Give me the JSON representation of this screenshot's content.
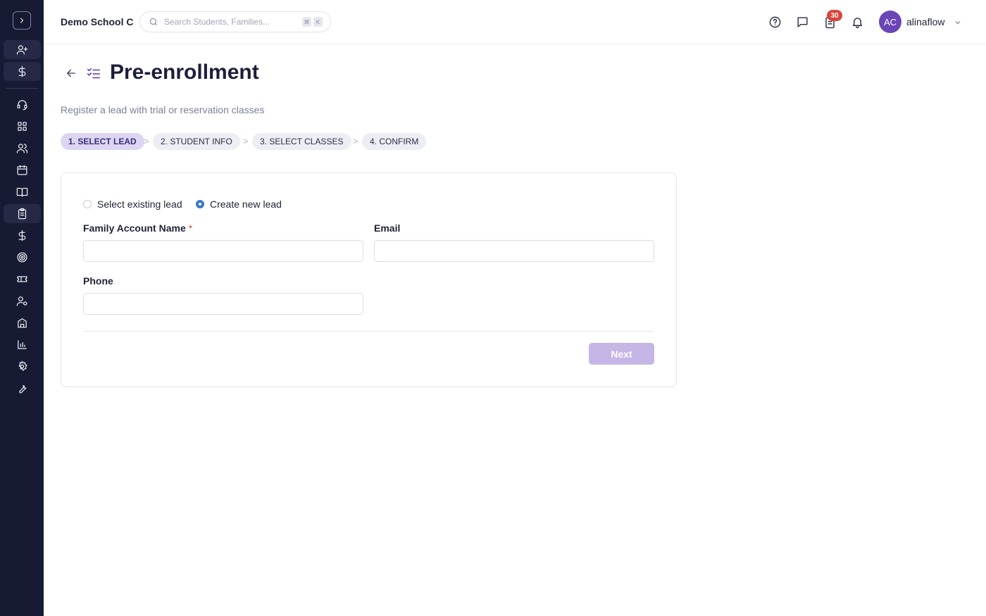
{
  "topbar": {
    "school_name": "Demo School C",
    "search_placeholder": "Search Students, Families...",
    "shortcut_keys": [
      "⌘",
      "K"
    ],
    "notification_badge": "30",
    "user": {
      "initials": "AC",
      "name": "alinaflow"
    }
  },
  "sidebar": {
    "items": [
      {
        "icon": "user-plus-icon"
      },
      {
        "icon": "dollar-icon"
      },
      {
        "icon": "headset-icon"
      },
      {
        "icon": "dashboard-icon"
      },
      {
        "icon": "users-icon"
      },
      {
        "icon": "calendar-icon"
      },
      {
        "icon": "book-icon"
      },
      {
        "icon": "clipboard-icon",
        "active": true
      },
      {
        "icon": "dollar-icon"
      },
      {
        "icon": "target-icon"
      },
      {
        "icon": "ticket-icon"
      },
      {
        "icon": "user-settings-icon"
      },
      {
        "icon": "building-icon"
      },
      {
        "icon": "bar-chart-icon"
      },
      {
        "icon": "gear-icon"
      },
      {
        "icon": "wrench-icon"
      }
    ]
  },
  "page": {
    "title": "Pre-enrollment",
    "subtitle": "Register a lead with trial or reservation classes",
    "steps": [
      {
        "label": "1. SELECT LEAD",
        "active": true
      },
      {
        "label": "2. STUDENT INFO",
        "active": false
      },
      {
        "label": "3. SELECT CLASSES",
        "active": false
      },
      {
        "label": "4. CONFIRM",
        "active": false
      }
    ],
    "step_separator": ">"
  },
  "form": {
    "radio_options": [
      {
        "label": "Select existing lead",
        "selected": false
      },
      {
        "label": "Create new lead",
        "selected": true
      }
    ],
    "fields": {
      "family_account_name": {
        "label": "Family Account Name",
        "required_mark": "*",
        "value": ""
      },
      "email": {
        "label": "Email",
        "value": ""
      },
      "phone": {
        "label": "Phone",
        "value": ""
      }
    },
    "next_label": "Next"
  },
  "colors": {
    "sidebar_bg": "#171a33",
    "accent": "#6a45b8",
    "active_step_bg": "#ded5f2",
    "badge": "#d9453c",
    "next_disabled": "#c5b6e6",
    "radio_selected": "#3a78c4"
  }
}
